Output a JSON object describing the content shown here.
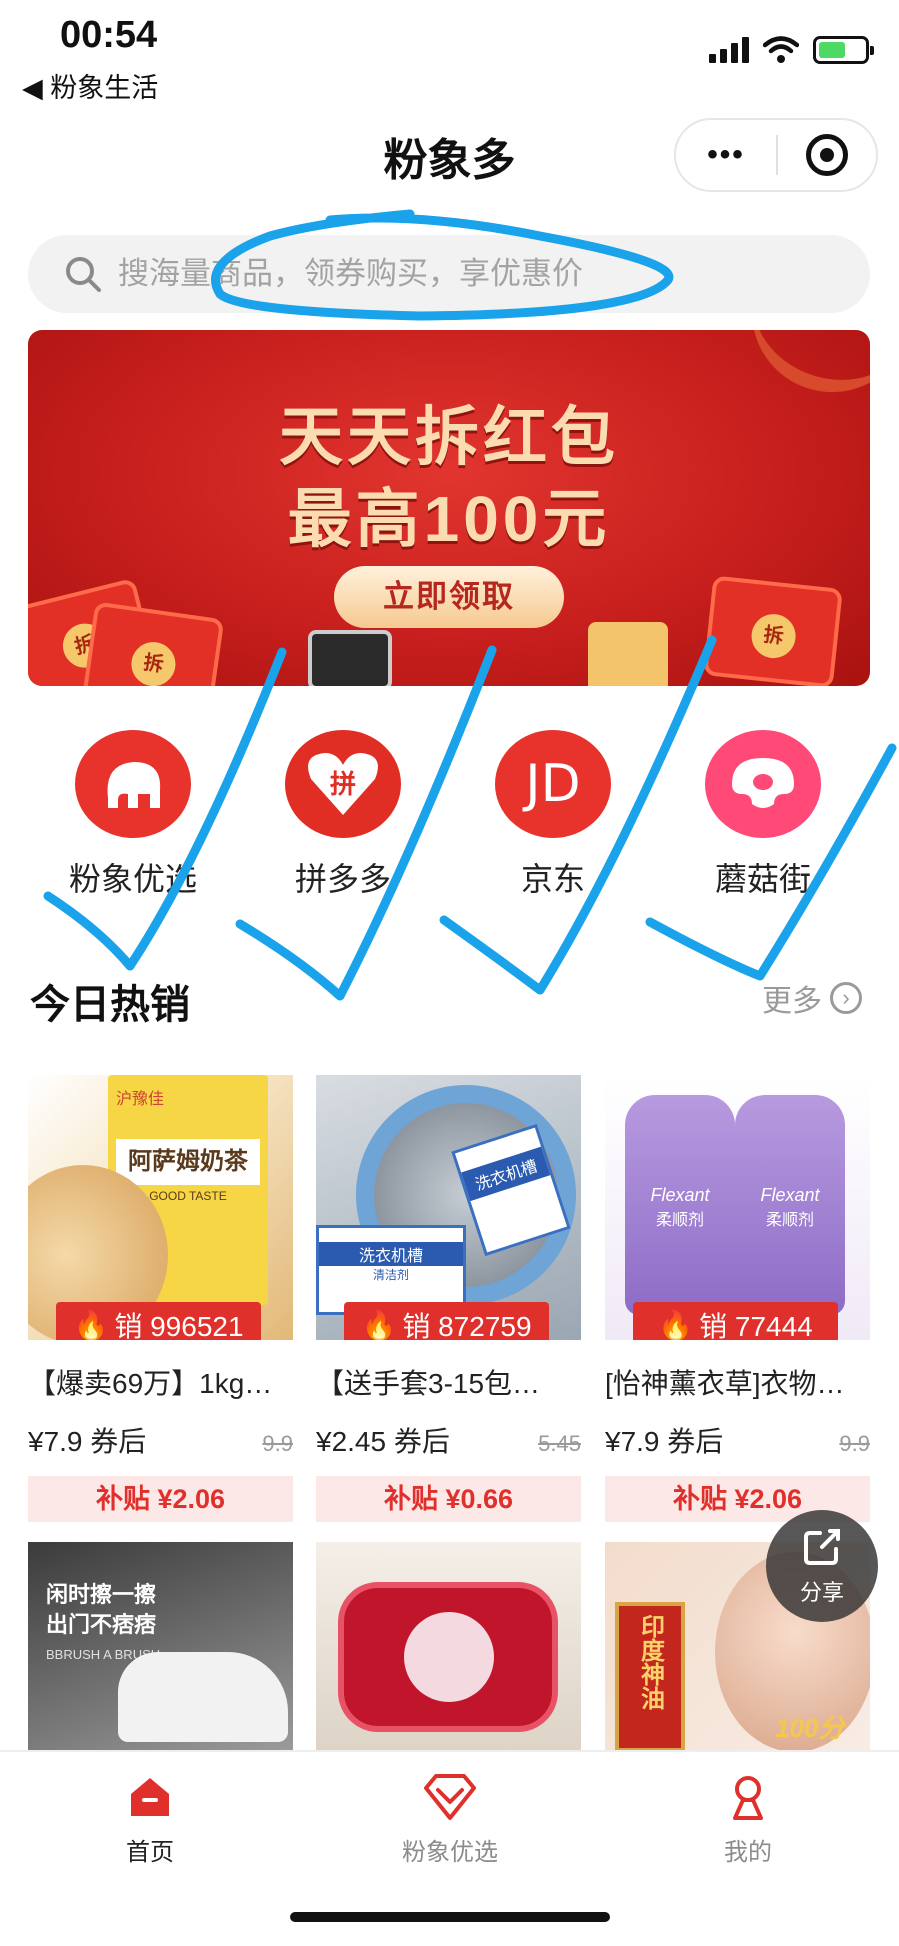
{
  "status_bar": {
    "time": "00:54",
    "back_label": "◀ 粉象生活"
  },
  "nav": {
    "title": "粉象多",
    "more_glyph": "•••"
  },
  "search": {
    "placeholder": "搜海量商品，领券购买，享优惠价"
  },
  "banner": {
    "title_line1": "天天拆红包",
    "title_line2": "最高100元",
    "button": "立即领取",
    "seal": "拆"
  },
  "platforms": [
    {
      "label": "粉象优选",
      "color": "#e8322c"
    },
    {
      "label": "拼多多",
      "color": "#e02e24",
      "icon_text": "拼"
    },
    {
      "label": "京东",
      "color": "#e8322c",
      "icon_text": "JD"
    },
    {
      "label": "蘑菇街",
      "color": "#ff4a78"
    }
  ],
  "section": {
    "title": "今日热销",
    "more": "更多"
  },
  "products": [
    {
      "sales": "销 996521",
      "title": "【爆卖69万】1kg…",
      "price": "¥7.9 券后",
      "original": "9.9",
      "subsidy": "补贴 ¥2.06",
      "img_text1": "阿萨姆奶茶",
      "img_text2": "GOOD TASTE",
      "img_text3": "沪豫佳"
    },
    {
      "sales": "销 872759",
      "title": "【送手套3-15包…",
      "price": "¥2.45 券后",
      "original": "5.45",
      "subsidy": "补贴 ¥0.66",
      "img_text1": "洗衣机槽",
      "img_text2": "清洁剂"
    },
    {
      "sales": "销 77444",
      "title": "[怡神薰衣草]衣物…",
      "price": "¥7.9 券后",
      "original": "9.9",
      "subsidy": "补贴 ¥2.06",
      "img_text1": "Flexant",
      "img_text2": "柔顺剂"
    }
  ],
  "products_row2": [
    {
      "img_text1": "闲时擦一擦",
      "img_text2": "出门不痞痞",
      "img_text3": "BBRUSH A BRUSH"
    },
    {
      "img_text1": ""
    },
    {
      "img_text1": "印度神油",
      "img_text2": "100分"
    }
  ],
  "share": {
    "label": "分享"
  },
  "tabbar": [
    {
      "label": "首页",
      "active": true
    },
    {
      "label": "粉象优选",
      "active": false
    },
    {
      "label": "我的",
      "active": false
    }
  ],
  "colors": {
    "accent": "#e0302b",
    "scribble": "#1aa3ea"
  }
}
